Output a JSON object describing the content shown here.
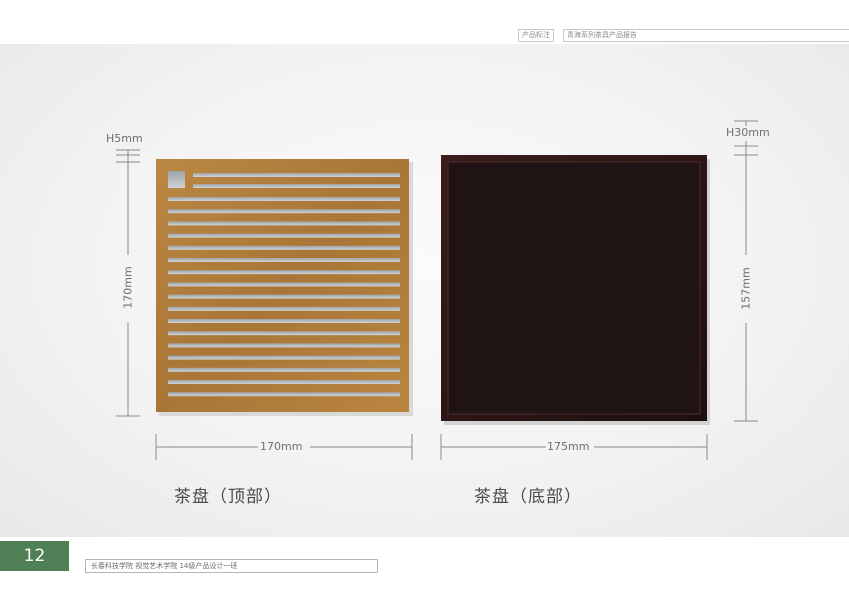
{
  "header": {
    "label": "产品标注",
    "title": "青海系列茶具产品报告"
  },
  "dimensions": {
    "top_height": "H5mm",
    "top_side": "170mm",
    "top_width": "170mm",
    "bottom_height": "H30mm",
    "bottom_side": "157mm",
    "bottom_width": "175mm"
  },
  "captions": {
    "top": "茶盘（顶部）",
    "bottom": "茶盘（底部）"
  },
  "footer": {
    "page_number": "12",
    "institution": "长春科技学院 视觉艺术学院 14级产品设计一班"
  },
  "colors": {
    "wood": "#b07b3c",
    "dark_tray": "#2a1716",
    "accent_green": "#4e7f55"
  }
}
